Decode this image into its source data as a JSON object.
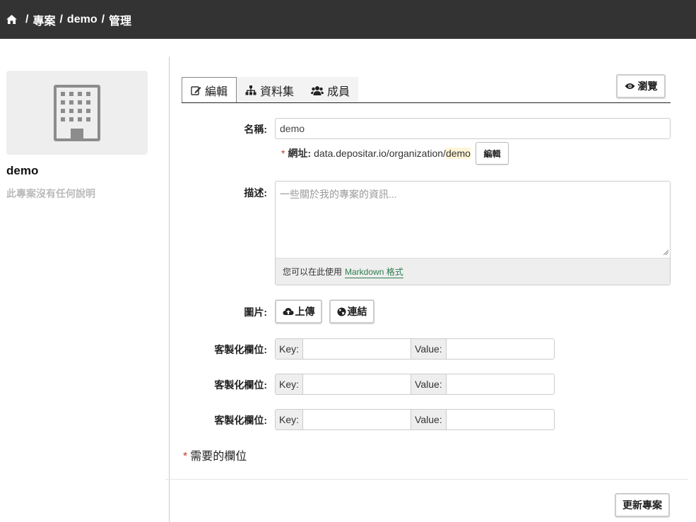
{
  "breadcrumb": {
    "home_icon": "home-icon",
    "items": [
      "專案",
      "demo",
      "管理"
    ],
    "separator": "/"
  },
  "sidebar": {
    "org_name": "demo",
    "org_description": "此專案沒有任何說明",
    "image_icon": "building-icon"
  },
  "tabs": [
    {
      "label": "編輯",
      "icon": "edit-icon",
      "active": true
    },
    {
      "label": "資料集",
      "icon": "sitemap-icon",
      "active": false
    },
    {
      "label": "成員",
      "icon": "users-icon",
      "active": false
    }
  ],
  "view_button": {
    "label": "瀏覽",
    "icon": "eye-icon"
  },
  "form": {
    "name_label": "名稱:",
    "name_value": "demo",
    "url": {
      "required_mark": "*",
      "label": "網址:",
      "prefix": "data.depositar.io/organization/",
      "slug": "demo",
      "edit_label": "編輯"
    },
    "description_label": "描述:",
    "description_placeholder": "一些關於我的專案的資訊...",
    "markdown_note_prefix": "您可以在此使用",
    "markdown_link": "Markdown 格式",
    "image_label": "圖片:",
    "upload_label": "上傳",
    "link_label": "連結",
    "custom_fields": [
      {
        "label": "客製化欄位:",
        "key_label": "Key:",
        "value_label": "Value:"
      },
      {
        "label": "客製化欄位:",
        "key_label": "Key:",
        "value_label": "Value:"
      },
      {
        "label": "客製化欄位:",
        "key_label": "Key:",
        "value_label": "Value:"
      }
    ],
    "required_note_mark": "*",
    "required_note": "需要的欄位",
    "submit_label": "更新專案"
  },
  "colors": {
    "topbar": "#333333",
    "required": "#c0392b",
    "markdown_link": "#2e7d4f"
  }
}
